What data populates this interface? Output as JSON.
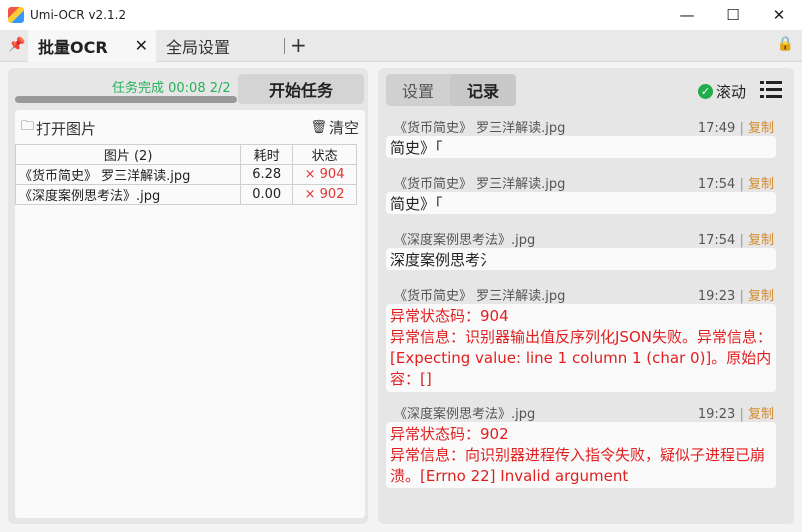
{
  "window": {
    "title": "Umi-OCR v2.1.2",
    "minimize": "—",
    "maximize": "☐",
    "close": "✕"
  },
  "tabs": {
    "active_label": "批量OCR",
    "inactive_label": "全局设置",
    "close_glyph": "✕",
    "add_glyph": "+"
  },
  "left": {
    "status": "任务完成  00:08  2/2",
    "start_button": "开始任务",
    "open_images": "打开图片",
    "clear": "清空",
    "columns": [
      "图片 (2)",
      "耗时",
      "状态"
    ],
    "rows": [
      {
        "name": "《货币简史》 罗三洋解读.jpg",
        "time": "6.28",
        "status": "× 904"
      },
      {
        "name": "《深度案例思考法》.jpg",
        "time": "0.00",
        "status": "× 902"
      }
    ]
  },
  "right": {
    "tab_settings": "设置",
    "tab_records": "记录",
    "scroll_label": "滚动",
    "copy_label": "复制",
    "records": [
      {
        "file": "《货币简史》 罗三洋解读.jpg",
        "time": "17:49",
        "text": "简史》「"
      },
      {
        "file": "《货币简史》 罗三洋解读.jpg",
        "time": "17:54",
        "text": "简史》「"
      },
      {
        "file": "《深度案例思考法》.jpg",
        "time": "17:54",
        "text": "深度案例思考氵"
      },
      {
        "file": "《货币简史》 罗三洋解读.jpg",
        "time": "19:23",
        "text": "异常状态码：904\n异常信息：识别器输出值反序列化JSON失败。异常信息：[Expecting value: line 1 column 1 (char 0)]。原始内容：[]"
      },
      {
        "file": "《深度案例思考法》.jpg",
        "time": "19:23",
        "text": "异常状态码：902\n异常信息：向识别器进程传入指令失败，疑似子进程已崩溃。[Errno 22] Invalid argument"
      }
    ]
  },
  "colors": {
    "success": "#26b35a",
    "error": "#e02020",
    "copy": "#d48a2a"
  }
}
